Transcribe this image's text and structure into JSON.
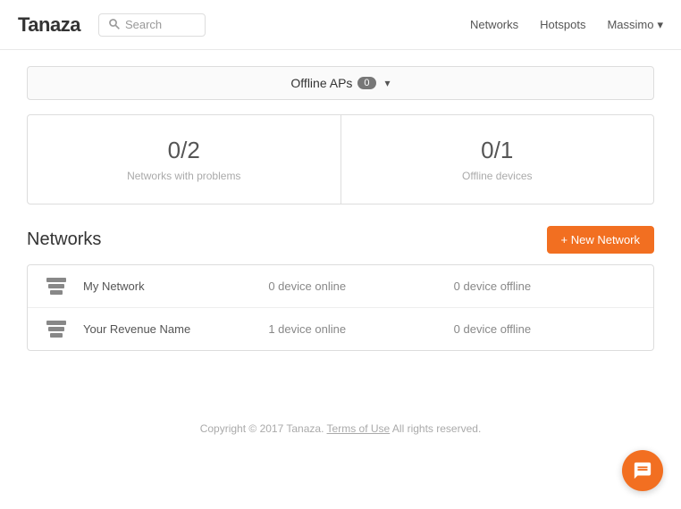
{
  "header": {
    "logo": "Tanaza",
    "search": {
      "placeholder": "Search"
    },
    "nav": {
      "networks": "Networks",
      "hotspots": "Hotspots",
      "user": "Massimo"
    }
  },
  "alert": {
    "label": "Offline APs",
    "count": "0"
  },
  "stats": [
    {
      "value": "0/2",
      "label": "Networks with problems"
    },
    {
      "value": "0/1",
      "label": "Offline devices"
    }
  ],
  "networks_section": {
    "title": "Networks",
    "new_button": "+ New Network",
    "rows": [
      {
        "name": "My Network",
        "online": "0 device online",
        "offline": "0 device offline"
      },
      {
        "name": "Your Revenue Name",
        "online": "1 device online",
        "offline": "0 device offline"
      }
    ]
  },
  "footer": {
    "text": "Copyright © 2017 Tanaza.",
    "link_text": "Terms of Use",
    "suffix": " All rights reserved."
  },
  "chat": {
    "label": "chat-icon"
  }
}
